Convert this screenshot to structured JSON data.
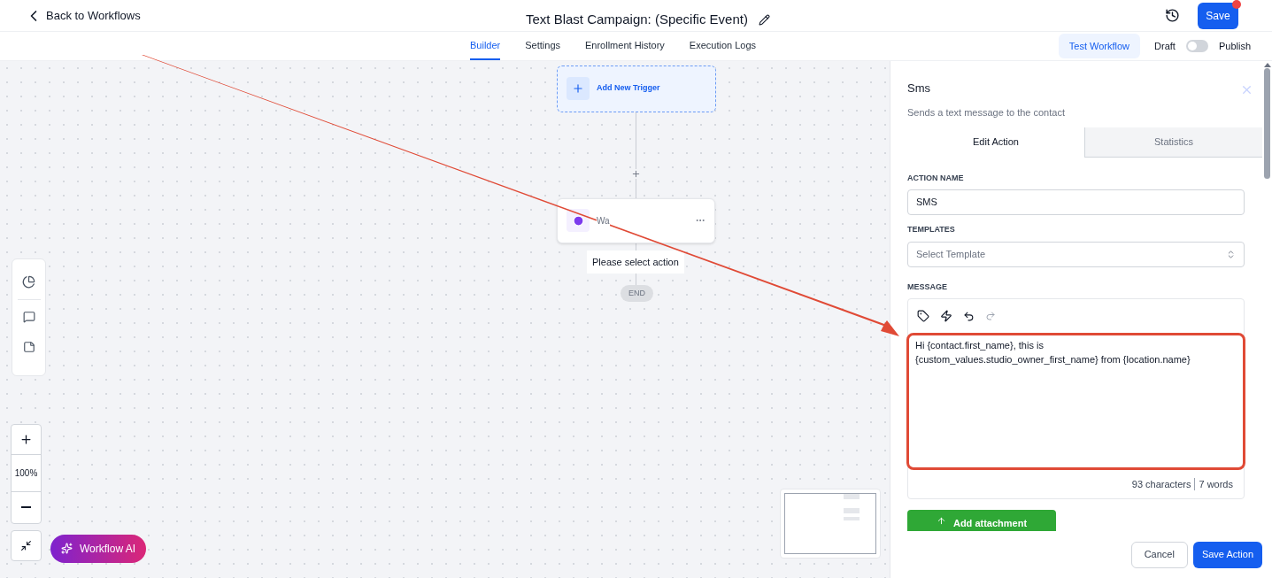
{
  "header": {
    "back": "Back to Workflows",
    "title": "Text Blast Campaign: (Specific Event)",
    "save": "Save",
    "unsaved": true
  },
  "tabs": [
    {
      "label": "Builder",
      "selected": true
    },
    {
      "label": "Settings",
      "selected": false
    },
    {
      "label": "Enrollment History",
      "selected": false
    },
    {
      "label": "Execution Logs",
      "selected": false
    }
  ],
  "test_workflow": "Test Workflow",
  "draft_label": "Draft",
  "publish_label": "Publish",
  "published": false,
  "canvas": {
    "trigger": "Add New Trigger",
    "action_node": "Wa",
    "hint": "Please select action",
    "end": "END",
    "zoom": "100%",
    "ai_button": "Workflow AI"
  },
  "panel": {
    "title": "Sms",
    "subtitle": "Sends a text message to the contact",
    "tabs": [
      {
        "label": "Edit Action",
        "selected": true
      },
      {
        "label": "Statistics",
        "selected": false
      }
    ],
    "action_name_label": "ACTION NAME",
    "action_name": "SMS",
    "templates_label": "TEMPLATES",
    "templates_placeholder": "Select Template",
    "message_label": "MESSAGE",
    "message": "Hi {contact.first_name}, this is {custom_values.studio_owner_first_name} from {location.name}",
    "characters": "93 characters",
    "words": "7 words",
    "attachment": "Add attachment",
    "cancel": "Cancel",
    "save_action": "Save Action"
  }
}
